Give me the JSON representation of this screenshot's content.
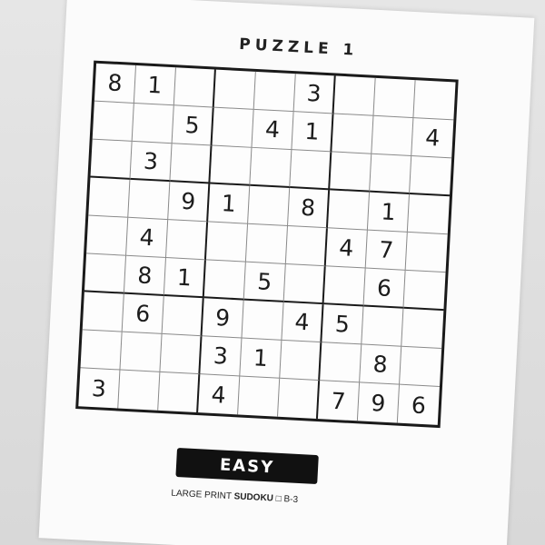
{
  "puzzle": {
    "title": "PUZZLE 1",
    "difficulty": "EASY",
    "footer": {
      "prefix": "LARGE PRINT ",
      "brand": "SUDOKU",
      "mark": " □  ",
      "code": "B-3"
    },
    "grid": [
      [
        "8",
        "1",
        "",
        "",
        "",
        "3",
        "",
        "",
        ""
      ],
      [
        "",
        "",
        "5",
        "",
        "4",
        "1",
        "",
        "",
        "4"
      ],
      [
        "",
        "3",
        "",
        "",
        "",
        "",
        "",
        "",
        ""
      ],
      [
        "",
        "",
        "9",
        "1",
        "",
        "8",
        "",
        "1",
        ""
      ],
      [
        "",
        "4",
        "",
        "",
        "",
        "",
        "4",
        "7",
        ""
      ],
      [
        "",
        "8",
        "1",
        "",
        "5",
        "",
        "",
        "6",
        ""
      ],
      [
        "",
        "6",
        "",
        "9",
        "",
        "4",
        "5",
        "",
        ""
      ],
      [
        "",
        "",
        "",
        "3",
        "1",
        "",
        "",
        "8",
        ""
      ],
      [
        "3",
        "",
        "",
        "4",
        "",
        "",
        "7",
        "9",
        "6"
      ]
    ]
  }
}
